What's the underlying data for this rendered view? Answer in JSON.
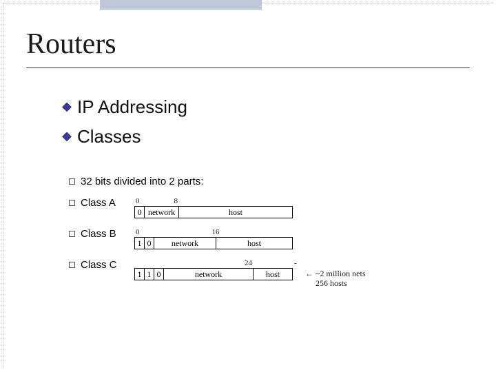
{
  "topbar": {},
  "title": "Routers",
  "bullets": {
    "items": [
      {
        "label": "IP Addressing"
      },
      {
        "label": "Classes"
      }
    ]
  },
  "diagram": {
    "intro": "32 bits divided into 2 parts:",
    "ticks": {
      "t0": "0",
      "t8": "8",
      "t16": "16",
      "t24": "24"
    },
    "classA": {
      "label": "Class A",
      "bits": "0",
      "net": "network",
      "host": "host"
    },
    "classB": {
      "label": "Class B",
      "bits0": "1",
      "bits1": "0",
      "net": "network",
      "host": "host"
    },
    "classC": {
      "label": "Class C",
      "bits0": "1",
      "bits1": "1",
      "bits2": "0",
      "net": "network",
      "host": "host"
    },
    "annot": {
      "dash": "-",
      "arrow": "←",
      "line1": "~2 million nets",
      "line2": "256 hosts"
    }
  }
}
